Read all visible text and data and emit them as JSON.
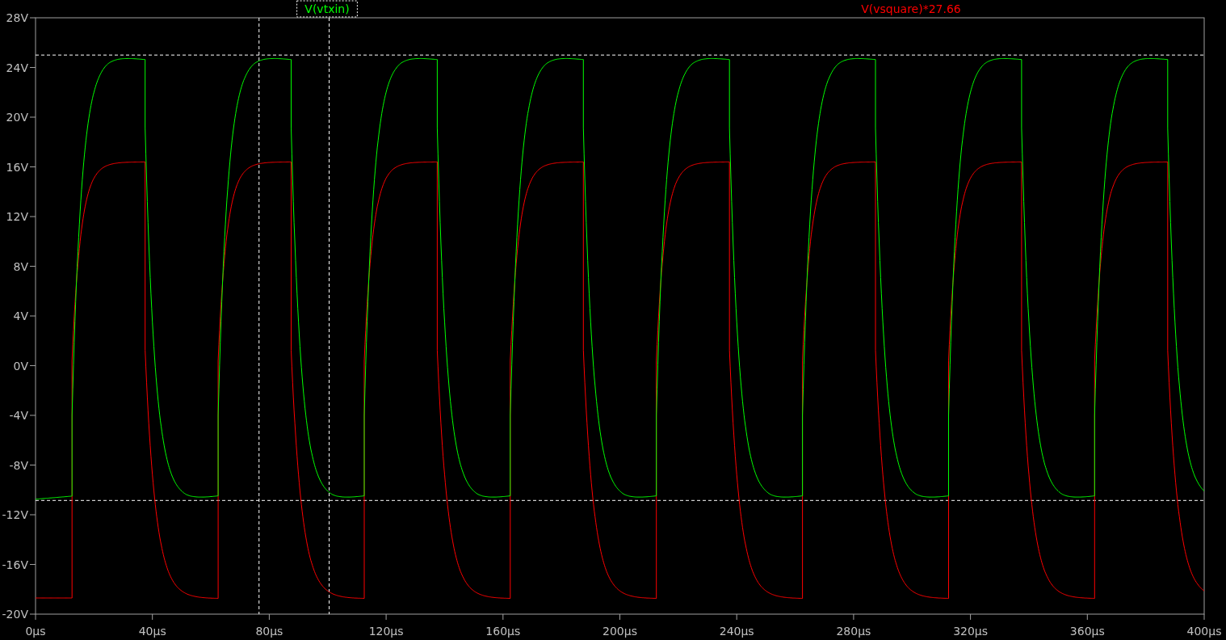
{
  "plot": {
    "traces": [
      {
        "label": "V(vtxin)",
        "color": "#00ff00",
        "selected": true
      },
      {
        "label": "V(vsquare)*27.66",
        "color": "#ff0000",
        "selected": false
      }
    ],
    "y_ticks": [
      "28V",
      "24V",
      "20V",
      "16V",
      "12V",
      "8V",
      "4V",
      "0V",
      "-4V",
      "-8V",
      "-12V",
      "-16V",
      "-20V"
    ],
    "x_ticks": [
      "0µs",
      "40µs",
      "80µs",
      "120µs",
      "160µs",
      "200µs",
      "240µs",
      "280µs",
      "320µs",
      "360µs",
      "400µs"
    ]
  }
}
